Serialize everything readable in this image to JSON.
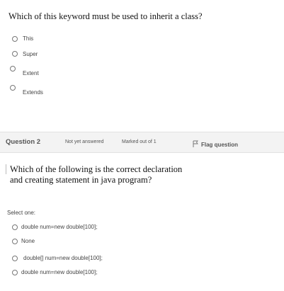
{
  "question1": {
    "title": "Which of this keyword must be used to inherit a class?",
    "options": [
      {
        "label": "This"
      },
      {
        "label": "Super"
      },
      {
        "label": "Extent"
      },
      {
        "label": "Extends"
      }
    ]
  },
  "question2": {
    "number_label": "Question 2",
    "status": "Not yet answered",
    "marks": "Marked out of 1",
    "flag_label": "Flag question",
    "text": "Which of the following is the correct declaration and creating statement in java program?",
    "select_prompt": "Select one:",
    "options": [
      {
        "label": "double num=new double[100];"
      },
      {
        "label": "None"
      },
      {
        "label": "double[] num=new double[100];"
      },
      {
        "label": "double num=new double[100];"
      }
    ]
  },
  "colors": {
    "bar_background": "#f3f3f3",
    "text": "#111111",
    "muted": "#555555"
  },
  "icons": {
    "flag": "flag-icon",
    "radio": "radio-button"
  }
}
